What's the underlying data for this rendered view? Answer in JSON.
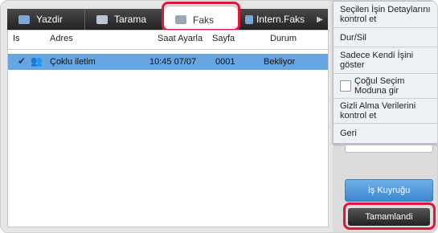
{
  "tabs": [
    {
      "label": "Yazdir",
      "active": false
    },
    {
      "label": "Tarama",
      "active": false
    },
    {
      "label": "Faks",
      "active": true
    },
    {
      "label": "Intern.Faks",
      "active": false
    }
  ],
  "table": {
    "headers": [
      "Is",
      "Adres",
      "Saat Ayarla",
      "Sayfa",
      "Durum"
    ],
    "rows": [
      {
        "address": "Çoklu iletim",
        "time": "10:45 07/07",
        "pages": "0001",
        "status": "Bekliyor"
      }
    ]
  },
  "menu": {
    "items": [
      "Seçilen İşin Detaylarını kontrol et",
      "Dur/Sil",
      "Sadece Kendi İşini göster",
      "Çoğul Seçim Moduna gir",
      "Gizli Alma Verilerini kontrol et",
      "Geri"
    ]
  },
  "buttons": {
    "queue": "İş Kuyruğu",
    "done": "Tamamlandi"
  },
  "colors": {
    "highlight": "#e0153a",
    "selected_row": "#66a5e0",
    "queue_button": "#4a92d8"
  },
  "icons": [
    "print-icon",
    "scan-icon",
    "fax-icon",
    "internet-fax-icon",
    "scroll-right-icon",
    "check-icon",
    "multi-recipient-icon"
  ]
}
